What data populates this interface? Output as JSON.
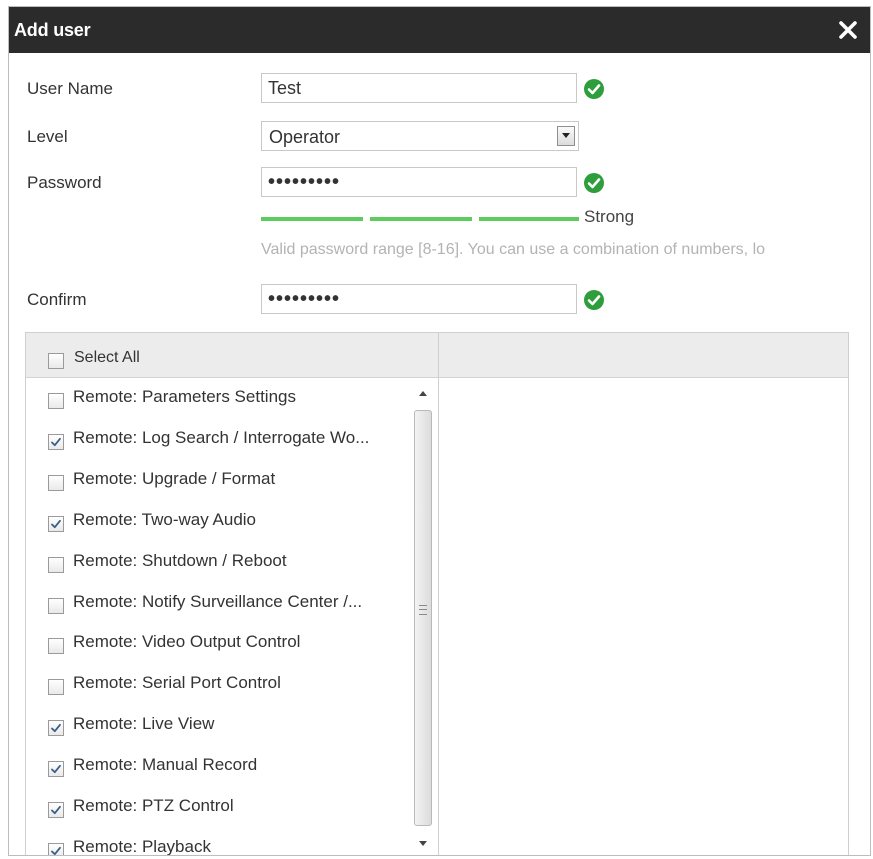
{
  "dialog": {
    "title": "Add user",
    "close_glyph": "✕"
  },
  "form": {
    "username": {
      "label": "User Name",
      "value": "Test",
      "status_icon": "check-circle-icon"
    },
    "level": {
      "label": "Level",
      "value": "Operator"
    },
    "password": {
      "label": "Password",
      "value": "•••••••••",
      "status_icon": "check-circle-icon"
    },
    "strength": {
      "label": "Strong",
      "segments_filled": 3,
      "segments_total": 3,
      "color": "#5ecb5e"
    },
    "hint": "Valid password range [8-16]. You can use a combination of numbers, lo",
    "confirm": {
      "label": "Confirm",
      "value": "•••••••••",
      "status_icon": "check-circle-icon"
    }
  },
  "permissions": {
    "select_all_label": "Select All",
    "select_all_checked": false,
    "items": [
      {
        "label": "Remote: Parameters Settings",
        "checked": false
      },
      {
        "label": "Remote: Log Search / Interrogate Wo...",
        "checked": true
      },
      {
        "label": "Remote: Upgrade / Format",
        "checked": false
      },
      {
        "label": "Remote: Two-way Audio",
        "checked": true
      },
      {
        "label": "Remote: Shutdown / Reboot",
        "checked": false
      },
      {
        "label": "Remote: Notify Surveillance Center /...",
        "checked": false
      },
      {
        "label": "Remote: Video Output Control",
        "checked": false
      },
      {
        "label": "Remote: Serial Port Control",
        "checked": false
      },
      {
        "label": "Remote: Live View",
        "checked": true
      },
      {
        "label": "Remote: Manual Record",
        "checked": true
      },
      {
        "label": "Remote: PTZ Control",
        "checked": true
      },
      {
        "label": "Remote: Playback",
        "checked": true
      }
    ]
  },
  "colors": {
    "titlebar": "#2b2b2b",
    "success": "#2e9e3c",
    "strength": "#5ecb5e"
  }
}
